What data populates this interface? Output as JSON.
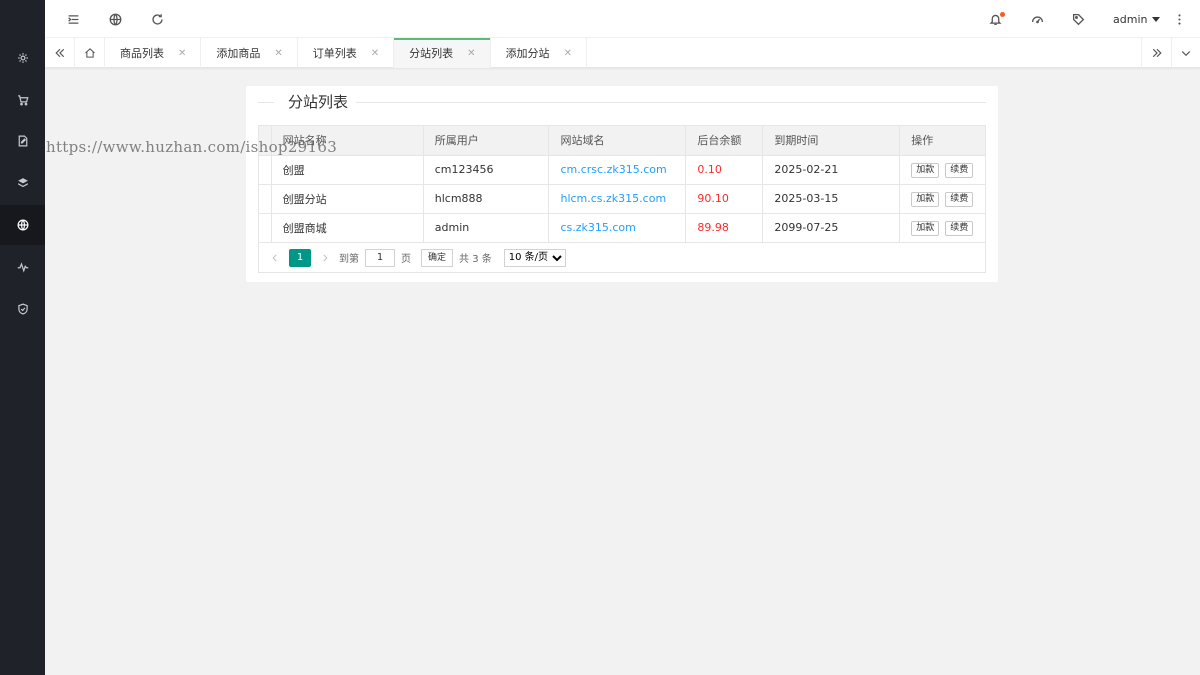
{
  "header": {
    "user_name": "admin",
    "icons": [
      "flexible-icon",
      "website-icon",
      "refresh-icon",
      "notice-icon",
      "theme-icon",
      "note-icon",
      "more-icon"
    ]
  },
  "tabs": [
    {
      "label": "商品列表",
      "active": false
    },
    {
      "label": "添加商品",
      "active": false
    },
    {
      "label": "订单列表",
      "active": false
    },
    {
      "label": "分站列表",
      "active": true
    },
    {
      "label": "添加分站",
      "active": false
    }
  ],
  "card": {
    "title": "分站列表"
  },
  "table": {
    "columns": [
      "网站名称",
      "所属用户",
      "网站域名",
      "后台余额",
      "到期时间",
      "操作"
    ],
    "rows": [
      {
        "name": "创盟",
        "user": "cm123456",
        "domain": "cm.crsc.zk315.com",
        "balance": "0.10",
        "expire": "2025-02-21"
      },
      {
        "name": "创盟分站",
        "user": "hlcm888",
        "domain": "hlcm.cs.zk315.com",
        "balance": "90.10",
        "expire": "2025-03-15"
      },
      {
        "name": "创盟商城",
        "user": "admin",
        "domain": "cs.zk315.com",
        "balance": "89.98",
        "expire": "2099-07-25"
      }
    ],
    "actions": {
      "add_funds": "加款",
      "renew": "续费"
    }
  },
  "pager": {
    "current_page": "1",
    "goto_label": "到第",
    "page_input": "1",
    "page_unit": "页",
    "confirm_label": "确定",
    "total_label": "共 3 条",
    "page_size_option": "10 条/页"
  },
  "watermark": "https://www.huzhan.com/ishop29163",
  "colors": {
    "sidebar_bg": "#20222a",
    "accent_green": "#009688",
    "link_blue": "#1e9fff",
    "balance_red": "#ff2a2a",
    "notice_dot": "#ff5722"
  }
}
